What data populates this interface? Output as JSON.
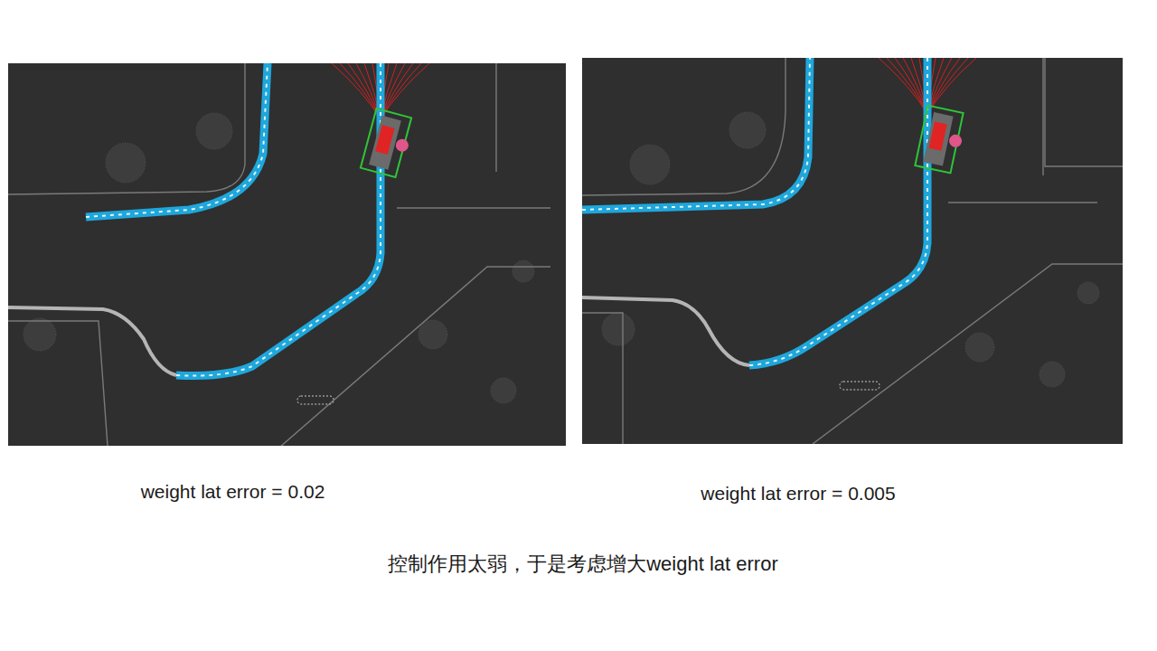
{
  "slide": {
    "panels": [
      {
        "caption": "weight lat error = 0.02"
      },
      {
        "caption": "weight lat error = 0.005"
      }
    ],
    "conclusion": "控制作用太弱，于是考虑增大weight lat error"
  }
}
